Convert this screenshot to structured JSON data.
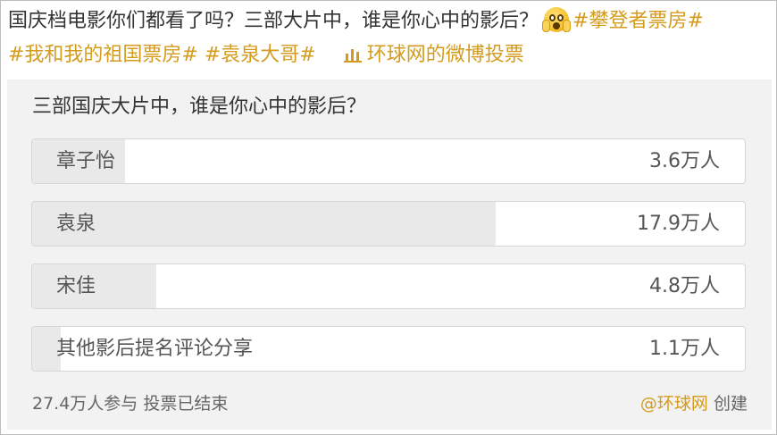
{
  "post": {
    "text": "国庆档电影你们都看了吗？三部大片中，谁是你心中的影后？",
    "emoji": "scream-emoji",
    "tags": [
      "#攀登者票房#",
      "#我和我的祖国票房#",
      "#袁泉大哥#"
    ],
    "link_icon": "chart-icon",
    "link_text": "环球网的微博投票"
  },
  "poll": {
    "question": "三部国庆大片中，谁是你心中的影后？",
    "options": [
      {
        "label": "章子怡",
        "count": "3.6万人",
        "value": 3.6
      },
      {
        "label": "袁泉",
        "count": "17.9万人",
        "value": 17.9
      },
      {
        "label": "宋佳",
        "count": "4.8万人",
        "value": 4.8
      },
      {
        "label": "其他影后提名评论分享",
        "count": "1.1万人",
        "value": 1.1
      }
    ],
    "participants": "27.4万人参与",
    "status": "投票已结束",
    "creator": "@环球网",
    "created_label": "创建"
  },
  "colors": {
    "accent": "#d49b1c",
    "poll_background": "#f2f2f2",
    "bar_fill": "#e9e9e9",
    "option_background": "#ffffff"
  }
}
